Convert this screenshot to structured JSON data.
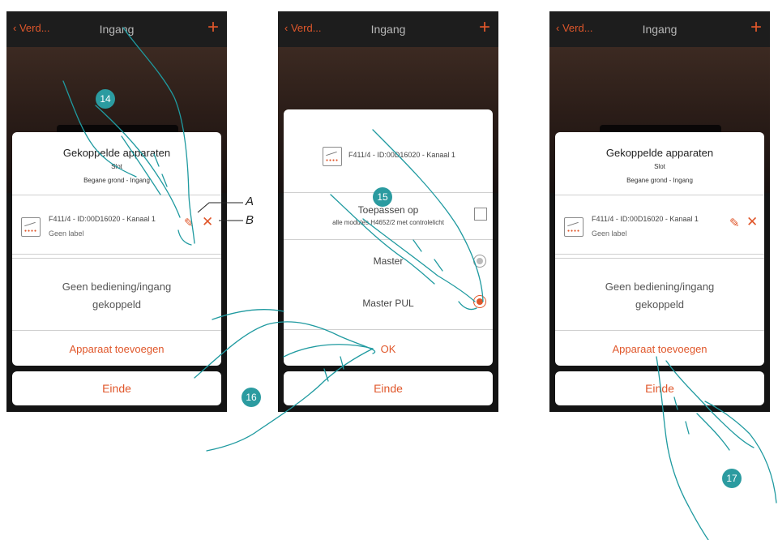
{
  "screens": [
    {
      "nav": {
        "back": "Verd...",
        "title": "Ingang"
      },
      "header": {
        "title": "Gekoppelde apparaten",
        "subtitle": "Slot",
        "location": "Begane grond - Ingang"
      },
      "device": {
        "name": "F411/4 - ID:00D16020 - Kanaal 1",
        "label": "Geen label"
      },
      "empty": {
        "line1": "Geen bediening/ingang",
        "line2": "gekoppeld"
      },
      "add": "Apparaat toevoegen",
      "finish": "Einde"
    },
    {
      "nav": {
        "back": "Verd...",
        "title": "Ingang"
      },
      "device": {
        "name": "F411/4 - ID:00D16020 - Kanaal 1"
      },
      "apply": {
        "title": "Toepassen op",
        "subtitle": "alle modules H4652/2 met controlelicht"
      },
      "options": [
        "Master",
        "Master PUL"
      ],
      "ok": "OK",
      "finish": "Einde"
    },
    {
      "nav": {
        "back": "Verd...",
        "title": "Ingang"
      },
      "header": {
        "title": "Gekoppelde apparaten",
        "subtitle": "Slot",
        "location": "Begane grond - Ingang"
      },
      "device": {
        "name": "F411/4 - ID:00D16020 - Kanaal 1",
        "label": "Geen label"
      },
      "empty": {
        "line1": "Geen bediening/ingang",
        "line2": "gekoppeld"
      },
      "add": "Apparaat toevoegen",
      "finish": "Einde"
    }
  ],
  "callouts": {
    "a": "A",
    "b": "B"
  },
  "steps": [
    "14",
    "15",
    "16",
    "17"
  ],
  "colors": {
    "accent": "#e0572b",
    "step": "#2b9ba0",
    "topbar": "#1d1d1d"
  }
}
